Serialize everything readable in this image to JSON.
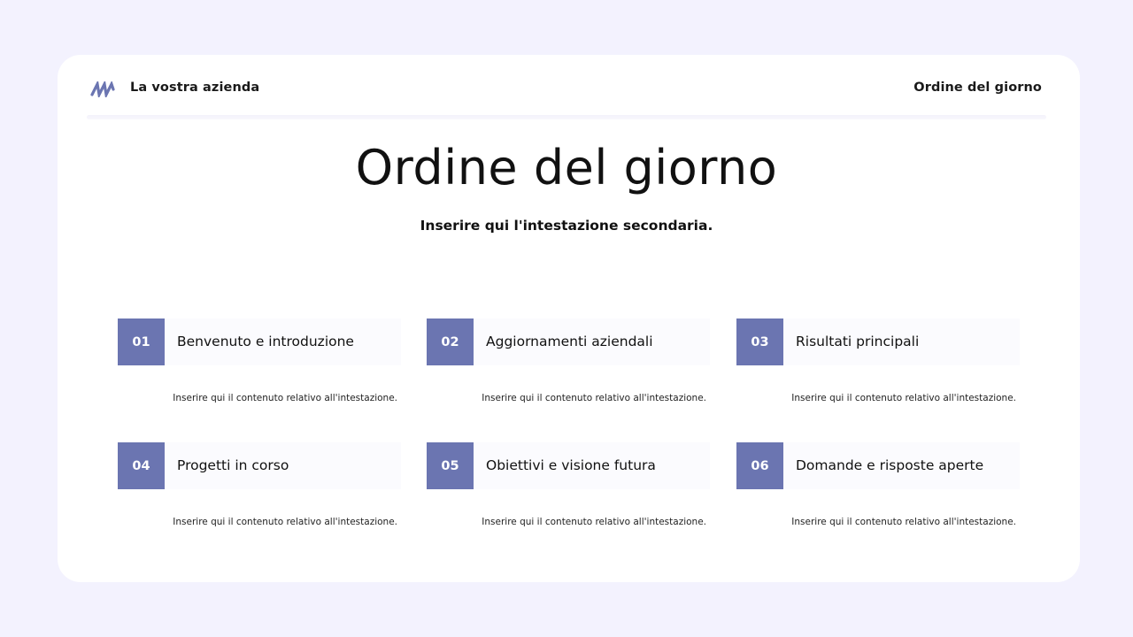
{
  "header": {
    "company": "La vostra azienda",
    "right_label": "Ordine del giorno",
    "logo_icon": "stripes-logo-icon"
  },
  "title": "Ordine del giorno",
  "subtitle": "Inserire qui l'intestazione secondaria.",
  "colors": {
    "background": "#f3f2fe",
    "accent": "#6b75b1",
    "card": "#ffffff"
  },
  "agenda": [
    {
      "number": "01",
      "heading": "Benvenuto e introduzione",
      "content": "Inserire qui il contenuto relativo all'intestazione."
    },
    {
      "number": "02",
      "heading": "Aggiornamenti aziendali",
      "content": "Inserire qui il contenuto relativo all'intestazione."
    },
    {
      "number": "03",
      "heading": "Risultati principali",
      "content": "Inserire qui il contenuto relativo all'intestazione."
    },
    {
      "number": "04",
      "heading": "Progetti in corso",
      "content": "Inserire qui il contenuto relativo all'intestazione."
    },
    {
      "number": "05",
      "heading": "Obiettivi e visione futura",
      "content": "Inserire qui il contenuto relativo all'intestazione."
    },
    {
      "number": "06",
      "heading": "Domande e risposte aperte",
      "content": "Inserire qui il contenuto relativo all'intestazione."
    }
  ]
}
